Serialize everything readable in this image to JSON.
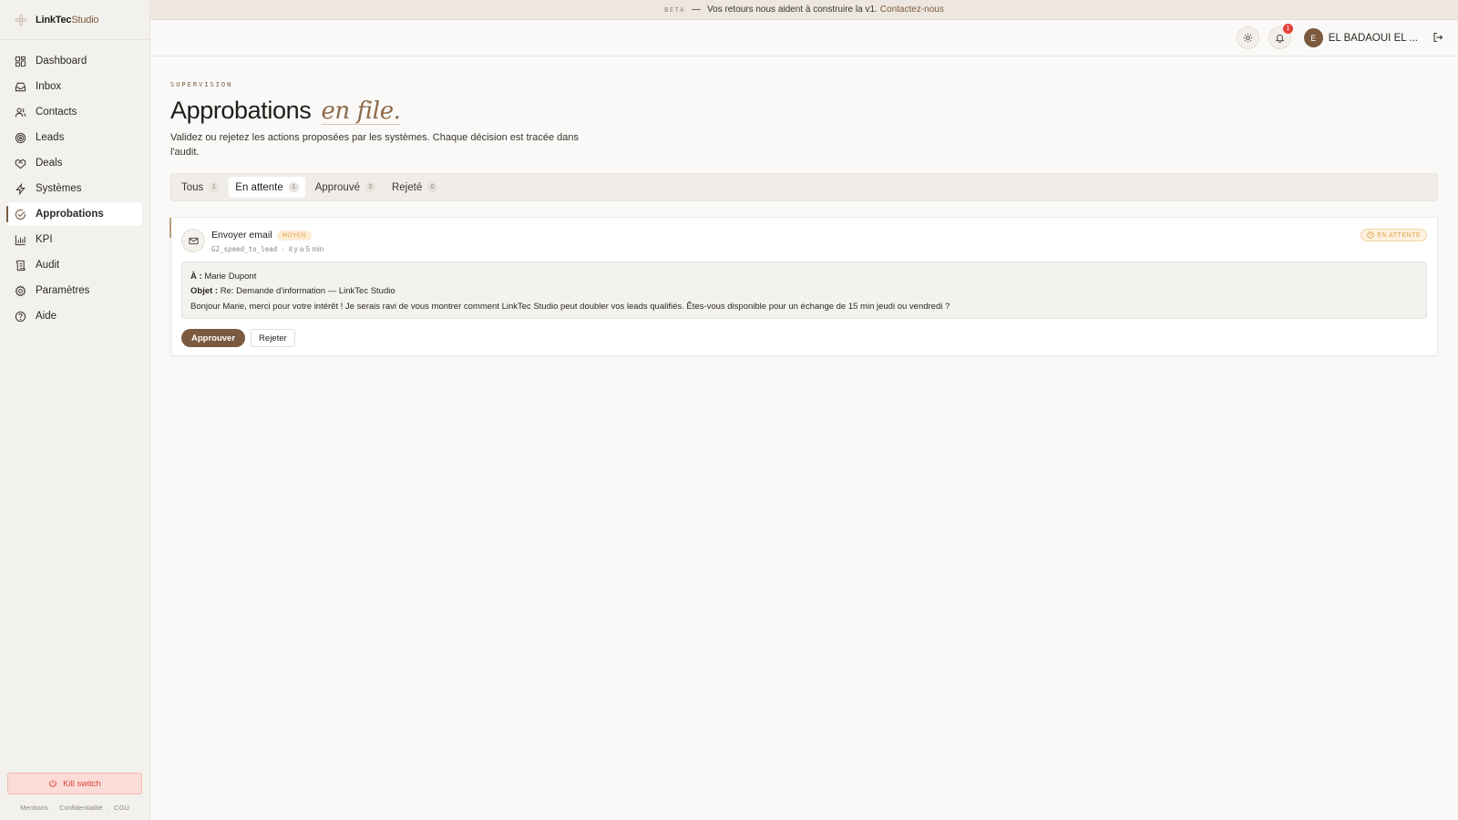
{
  "brand": {
    "name": "LinkTec",
    "accent": "Studio",
    "logo_icon": "flower-logo-icon"
  },
  "sidebar": {
    "items": [
      {
        "label": "Dashboard",
        "icon": "grid-icon"
      },
      {
        "label": "Inbox",
        "icon": "inbox-icon"
      },
      {
        "label": "Contacts",
        "icon": "users-icon"
      },
      {
        "label": "Leads",
        "icon": "target-icon"
      },
      {
        "label": "Deals",
        "icon": "handshake-icon"
      },
      {
        "label": "Systèmes",
        "icon": "bolt-icon"
      },
      {
        "label": "Approbations",
        "icon": "check-circle-icon",
        "active": true
      },
      {
        "label": "KPI",
        "icon": "bar-chart-icon"
      },
      {
        "label": "Audit",
        "icon": "scroll-icon"
      },
      {
        "label": "Paramètres",
        "icon": "gear-icon"
      },
      {
        "label": "Aide",
        "icon": "help-icon"
      }
    ],
    "kill_switch": "Kill switch",
    "legal": [
      "Mentions",
      "Confidentialité",
      "CGU"
    ]
  },
  "beta_banner": {
    "tag": "BETA",
    "dash": "—",
    "text": "Vos retours nous aident à construire la v1.",
    "link": "Contactez-nous"
  },
  "topbar": {
    "notification_count": "1",
    "user_initial": "E",
    "user_name": "EL BADAOUI EL ..."
  },
  "page": {
    "eyebrow": "SUPERVISION",
    "title": "Approbations",
    "title_italic": "en file.",
    "subtitle": "Validez ou rejetez les actions proposées par les systèmes. Chaque décision est tracée dans l'audit."
  },
  "tabs": [
    {
      "label": "Tous",
      "count": "1"
    },
    {
      "label": "En attente",
      "count": "1",
      "active": true
    },
    {
      "label": "Approuvé",
      "count": "0"
    },
    {
      "label": "Rejeté",
      "count": "0"
    }
  ],
  "approval": {
    "title": "Envoyer email",
    "priority": "MOYEN",
    "system": "G2_speed_to_lead",
    "meta_sep": "·",
    "time": "il y a 5 min",
    "status": "EN ATTENTE",
    "to_label": "À :",
    "to": "Marie Dupont",
    "subject_label": "Objet :",
    "subject": "Re: Demande d'information — LinkTec Studio",
    "body": "Bonjour Marie, merci pour votre intérêt ! Je serais ravi de vous montrer comment LinkTec Studio peut doubler vos leads qualifiés. Êtes-vous disponible pour un échange de 15 min jeudi ou vendredi ?",
    "approve_label": "Approuver",
    "reject_label": "Rejeter"
  },
  "colors": {
    "accent": "#7b5a3f",
    "background": "#faf9f7",
    "sidebar": "#f3f1ed",
    "warning": "#e0a34a",
    "danger": "#d9473a"
  }
}
